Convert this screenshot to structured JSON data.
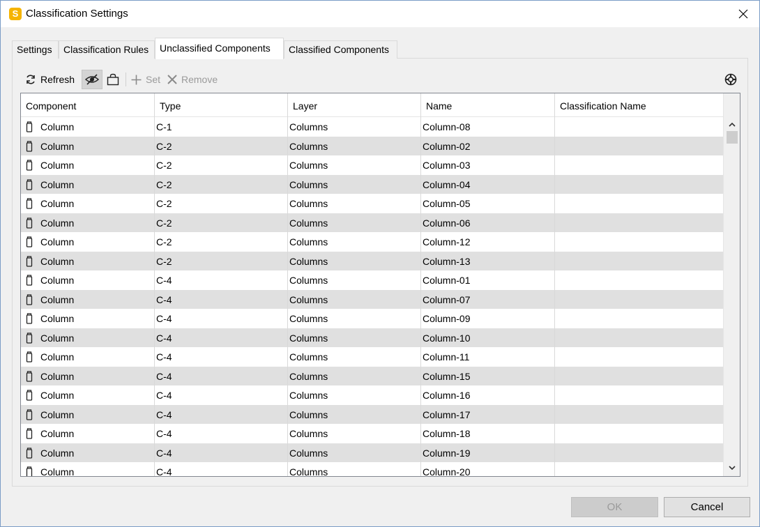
{
  "window": {
    "title": "Classification Settings",
    "app_icon_letter": "S"
  },
  "tabs": [
    {
      "label": "Settings",
      "active": false
    },
    {
      "label": "Classification Rules",
      "active": false
    },
    {
      "label": "Unclassified Components",
      "active": true
    },
    {
      "label": "Classified Components",
      "active": false
    }
  ],
  "toolbar": {
    "refresh_label": "Refresh",
    "set_label": "Set",
    "remove_label": "Remove"
  },
  "table": {
    "columns": [
      "Component",
      "Type",
      "Layer",
      "Name",
      "Classification Name"
    ],
    "rows": [
      {
        "component": "Column",
        "type": "C-1",
        "layer": "Columns",
        "name": "Column-08",
        "classification": ""
      },
      {
        "component": "Column",
        "type": "C-2",
        "layer": "Columns",
        "name": "Column-02",
        "classification": ""
      },
      {
        "component": "Column",
        "type": "C-2",
        "layer": "Columns",
        "name": "Column-03",
        "classification": ""
      },
      {
        "component": "Column",
        "type": "C-2",
        "layer": "Columns",
        "name": "Column-04",
        "classification": ""
      },
      {
        "component": "Column",
        "type": "C-2",
        "layer": "Columns",
        "name": "Column-05",
        "classification": ""
      },
      {
        "component": "Column",
        "type": "C-2",
        "layer": "Columns",
        "name": "Column-06",
        "classification": ""
      },
      {
        "component": "Column",
        "type": "C-2",
        "layer": "Columns",
        "name": "Column-12",
        "classification": ""
      },
      {
        "component": "Column",
        "type": "C-2",
        "layer": "Columns",
        "name": "Column-13",
        "classification": ""
      },
      {
        "component": "Column",
        "type": "C-4",
        "layer": "Columns",
        "name": "Column-01",
        "classification": ""
      },
      {
        "component": "Column",
        "type": "C-4",
        "layer": "Columns",
        "name": "Column-07",
        "classification": ""
      },
      {
        "component": "Column",
        "type": "C-4",
        "layer": "Columns",
        "name": "Column-09",
        "classification": ""
      },
      {
        "component": "Column",
        "type": "C-4",
        "layer": "Columns",
        "name": "Column-10",
        "classification": ""
      },
      {
        "component": "Column",
        "type": "C-4",
        "layer": "Columns",
        "name": "Column-11",
        "classification": ""
      },
      {
        "component": "Column",
        "type": "C-4",
        "layer": "Columns",
        "name": "Column-15",
        "classification": ""
      },
      {
        "component": "Column",
        "type": "C-4",
        "layer": "Columns",
        "name": "Column-16",
        "classification": ""
      },
      {
        "component": "Column",
        "type": "C-4",
        "layer": "Columns",
        "name": "Column-17",
        "classification": ""
      },
      {
        "component": "Column",
        "type": "C-4",
        "layer": "Columns",
        "name": "Column-18",
        "classification": ""
      },
      {
        "component": "Column",
        "type": "C-4",
        "layer": "Columns",
        "name": "Column-19",
        "classification": ""
      },
      {
        "component": "Column",
        "type": "C-4",
        "layer": "Columns",
        "name": "Column-20",
        "classification": ""
      }
    ]
  },
  "footer": {
    "ok_label": "OK",
    "cancel_label": "Cancel"
  },
  "colors": {
    "app_icon": "#f5b400",
    "row_alt": "#e0e0e0",
    "disabled_text": "#9a9a9a"
  },
  "icons": {
    "refresh": "refresh-icon",
    "hide_toggle": "eye-hidden-icon",
    "bag": "bag-icon",
    "set": "plus-icon",
    "remove": "x-icon",
    "help": "lifebuoy-icon",
    "row": "column-component-icon"
  }
}
